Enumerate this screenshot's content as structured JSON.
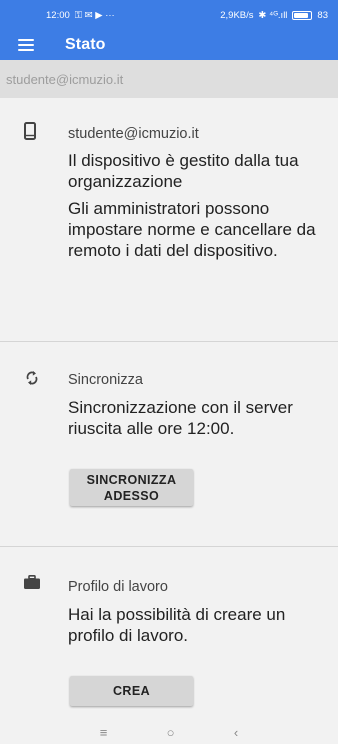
{
  "status_bar": {
    "time": "12:00",
    "notif_icons": "⚿ ✉ ▶ ···",
    "speed": "2,9KB/s",
    "sys_icons": "✱ ⁴ᴳ.ıll",
    "battery_text": "83",
    "battery_level": 0.83
  },
  "app_bar": {
    "menu_icon": "hamburger-menu-icon",
    "title": "Stato"
  },
  "account_bar": {
    "email": "studente@icmuzio.it"
  },
  "device_section": {
    "icon": "smartphone-icon",
    "heading": "studente@icmuzio.it",
    "managed_text": "Il dispositivo è gestito dalla tua organizzazione",
    "admin_text": "Gli amministratori possono impostare norme e cancellare da remoto i dati del dispositivo."
  },
  "sync_section": {
    "icon": "sync-icon",
    "heading": "Sincronizza",
    "status_text": "Sincronizzazione con il server riuscita alle ore 12:00.",
    "button_line1": "SINCRONIZZA",
    "button_line2": "ADESSO"
  },
  "work_section": {
    "icon": "briefcase-icon",
    "heading": "Profilo di lavoro",
    "text": "Hai la possibilità di creare un profilo di lavoro.",
    "button_label": "CREA"
  },
  "nav_bar": {
    "recents": "≡",
    "home": "○",
    "back": "‹"
  }
}
